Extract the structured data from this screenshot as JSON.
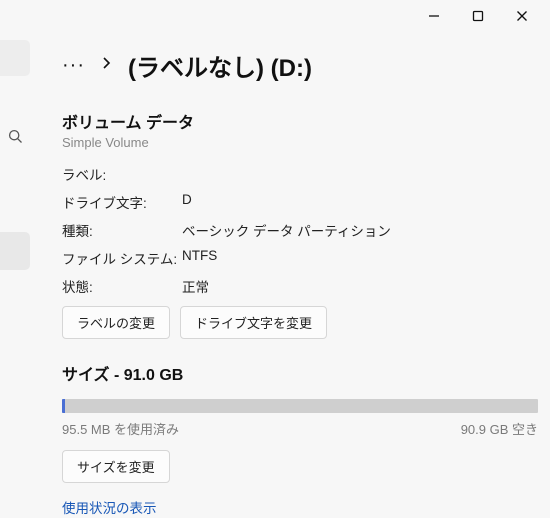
{
  "titlebar": {
    "minimize_icon": "minimize",
    "maximize_icon": "maximize",
    "close_icon": "close"
  },
  "breadcrumb": {
    "more_label": "···",
    "title": "(ラベルなし) (D:)"
  },
  "volume": {
    "section_title": "ボリューム データ",
    "subtitle": "Simple Volume",
    "rows": {
      "label": {
        "k": "ラベル:",
        "v": ""
      },
      "letter": {
        "k": "ドライブ文字:",
        "v": "D"
      },
      "type": {
        "k": "種類:",
        "v": "ベーシック データ パーティション"
      },
      "fs": {
        "k": "ファイル システム:",
        "v": "NTFS"
      },
      "state": {
        "k": "状態:",
        "v": "正常"
      }
    },
    "buttons": {
      "change_label": "ラベルの変更",
      "change_letter": "ドライブ文字を変更"
    }
  },
  "size": {
    "title": "サイズ - 91.0 GB",
    "used_text": "95.5 MB を使用済み",
    "free_text": "90.9 GB 空き",
    "button": "サイズを変更",
    "colors": {
      "fill": "#4a6fd4",
      "track": "#cfcfcf"
    }
  },
  "link": {
    "usage": "使用状況の表示"
  }
}
